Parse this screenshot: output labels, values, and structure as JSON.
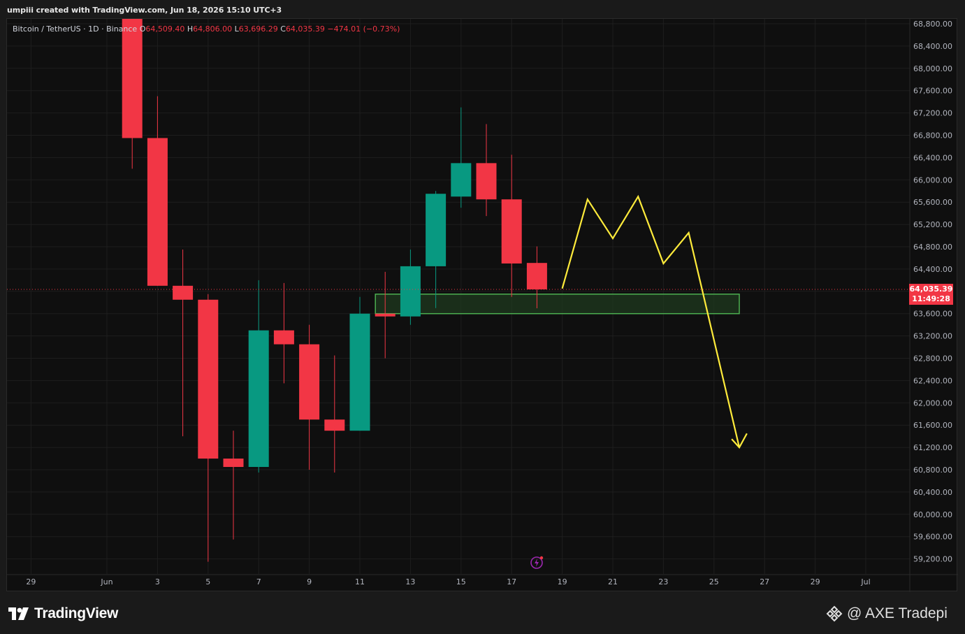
{
  "header": {
    "creator_line": "umpiii created with TradingView.com, Jun 18, 2026 15:10 UTC+3"
  },
  "legend": {
    "symbol": "Bitcoin / TetherUS · 1D · Binance",
    "open_label": "O",
    "open": "64,509.40",
    "high_label": "H",
    "high": "64,806.00",
    "low_label": "L",
    "low": "63,696.29",
    "close_label": "C",
    "close": "64,035.39",
    "change": "−474.01 (−0.73%)"
  },
  "last_price": {
    "price": "64,035.39",
    "countdown": "11:49:28"
  },
  "footer": {
    "brand": "TradingView",
    "watermark": "@ AXE Tradepi"
  },
  "colors": {
    "up": "#089981",
    "down": "#f23645",
    "projection": "#ffeb3b",
    "zone_border": "#4caf50",
    "zone_fill": "#1f3a1f",
    "background": "#0f0f0f"
  },
  "icons": {
    "tv_logo": "tradingview-logo-icon",
    "flash": "lightning-icon",
    "exchange": "binance-icon"
  },
  "chart_data": {
    "type": "candlestick",
    "symbol": "BTCUSDT",
    "interval": "1D",
    "ylim": [
      59000,
      68900
    ],
    "y_ticks": [
      "68,800.00",
      "68,400.00",
      "68,000.00",
      "67,600.00",
      "67,200.00",
      "66,800.00",
      "66,400.00",
      "66,000.00",
      "65,600.00",
      "65,200.00",
      "64,800.00",
      "64,400.00",
      "64,000.00",
      "63,600.00",
      "63,200.00",
      "62,800.00",
      "62,400.00",
      "62,000.00",
      "61,600.00",
      "61,200.00",
      "60,800.00",
      "60,400.00",
      "60,000.00",
      "59,600.00",
      "59,200.00"
    ],
    "x_ticks": [
      {
        "label": "29",
        "day": -2
      },
      {
        "label": "Jun",
        "day": 1
      },
      {
        "label": "3",
        "day": 3
      },
      {
        "label": "5",
        "day": 5
      },
      {
        "label": "7",
        "day": 7
      },
      {
        "label": "9",
        "day": 9
      },
      {
        "label": "11",
        "day": 11
      },
      {
        "label": "13",
        "day": 13
      },
      {
        "label": "15",
        "day": 15
      },
      {
        "label": "17",
        "day": 17
      },
      {
        "label": "19",
        "day": 19
      },
      {
        "label": "21",
        "day": 21
      },
      {
        "label": "23",
        "day": 23
      },
      {
        "label": "25",
        "day": 25
      },
      {
        "label": "27",
        "day": 27
      },
      {
        "label": "29",
        "day": 29
      },
      {
        "label": "Jul",
        "day": 31
      }
    ],
    "candles": [
      {
        "day": 2,
        "open": 68900,
        "high": 68900,
        "low": 66200,
        "close": 66750
      },
      {
        "day": 3,
        "open": 66750,
        "high": 67500,
        "low": 64100,
        "close": 64100
      },
      {
        "day": 4,
        "open": 64100,
        "high": 64750,
        "low": 61400,
        "close": 63850
      },
      {
        "day": 5,
        "open": 63850,
        "high": 63950,
        "low": 59150,
        "close": 61000
      },
      {
        "day": 6,
        "open": 61000,
        "high": 61500,
        "low": 59550,
        "close": 60850
      },
      {
        "day": 7,
        "open": 60850,
        "high": 64200,
        "low": 60750,
        "close": 63300
      },
      {
        "day": 8,
        "open": 63300,
        "high": 64150,
        "low": 62350,
        "close": 63050
      },
      {
        "day": 9,
        "open": 63050,
        "high": 63400,
        "low": 60800,
        "close": 61700
      },
      {
        "day": 10,
        "open": 61700,
        "high": 62850,
        "low": 60750,
        "close": 61500
      },
      {
        "day": 11,
        "open": 61500,
        "high": 63900,
        "low": 61500,
        "close": 63600
      },
      {
        "day": 12,
        "open": 63600,
        "high": 64350,
        "low": 62800,
        "close": 63550
      },
      {
        "day": 13,
        "open": 63550,
        "high": 64750,
        "low": 63400,
        "close": 64450
      },
      {
        "day": 14,
        "open": 64450,
        "high": 65800,
        "low": 63700,
        "close": 65750
      },
      {
        "day": 15,
        "open": 65700,
        "high": 67300,
        "low": 65500,
        "close": 66300
      },
      {
        "day": 16,
        "open": 66300,
        "high": 67000,
        "low": 65350,
        "close": 65650
      },
      {
        "day": 17,
        "open": 65650,
        "high": 66450,
        "low": 63900,
        "close": 64500
      },
      {
        "day": 18,
        "open": 64509.4,
        "high": 64806,
        "low": 63696.29,
        "close": 64035.39
      }
    ],
    "support_zone": {
      "from_day": 12,
      "to_day": 26,
      "top": 63950,
      "bottom": 63600
    },
    "projection_path": [
      {
        "day": 19,
        "price": 64050
      },
      {
        "day": 20,
        "price": 65650
      },
      {
        "day": 21,
        "price": 64950
      },
      {
        "day": 22,
        "price": 65700
      },
      {
        "day": 23,
        "price": 64500
      },
      {
        "day": 24,
        "price": 65050
      },
      {
        "day": 26,
        "price": 61200
      }
    ],
    "projection_arrowhead": [
      {
        "day": 25.7,
        "price": 61350
      },
      {
        "day": 26,
        "price": 61200
      },
      {
        "day": 26.3,
        "price": 61450
      }
    ],
    "last_price": 64035.39
  }
}
